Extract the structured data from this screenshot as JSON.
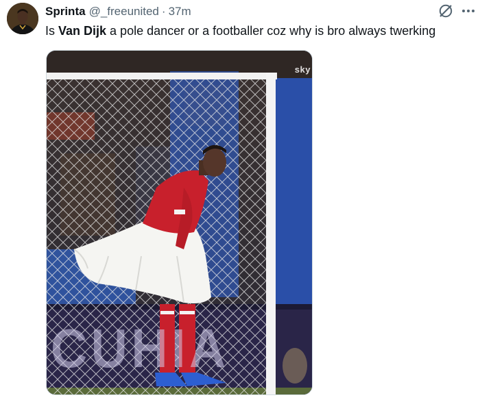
{
  "tweet": {
    "author_name": "Sprinta",
    "author_handle": "@_freeunited",
    "separator": "·",
    "time_ago": "37m",
    "text_before": "Is ",
    "text_bold": "Van Dijk",
    "text_after": " a pole dancer or a footballer coz why is bro always twerking"
  },
  "media": {
    "broadcast_logo": "sky",
    "ad_board_text": "CUHIA"
  },
  "icons": {
    "grok": "grok-icon",
    "more": "more-icon"
  },
  "colors": {
    "text_primary": "#0f1419",
    "text_secondary": "#536471",
    "kit_red": "#c8202c",
    "skirt_white": "#f5f5f2",
    "stand_blue": "#2a4fa8"
  }
}
